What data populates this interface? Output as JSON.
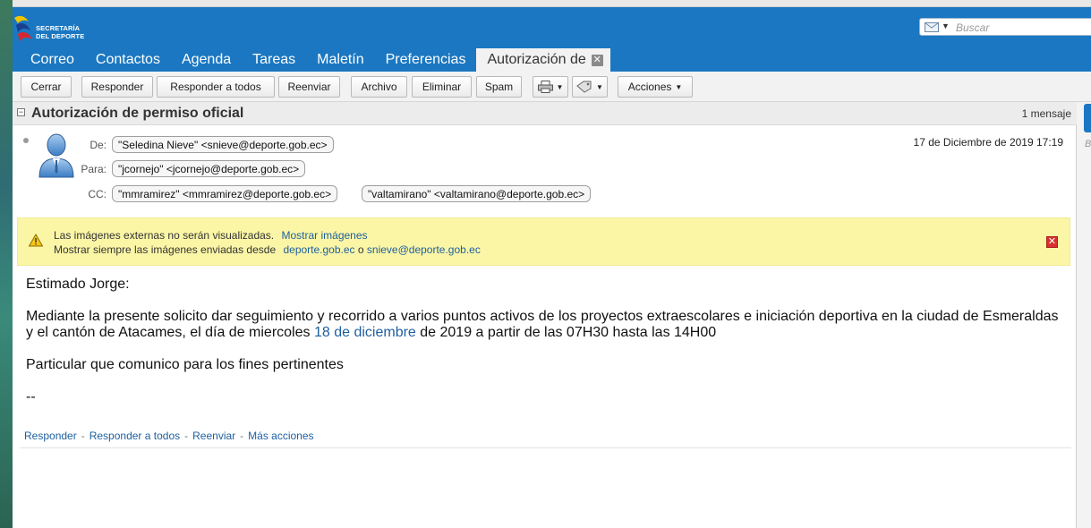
{
  "app": {
    "logo_lines": [
      "SECRETARÍA",
      "DEL DEPORTE"
    ]
  },
  "search": {
    "placeholder": "Buscar"
  },
  "tabs": [
    {
      "label": "Correo"
    },
    {
      "label": "Contactos"
    },
    {
      "label": "Agenda"
    },
    {
      "label": "Tareas"
    },
    {
      "label": "Maletín"
    },
    {
      "label": "Preferencias"
    },
    {
      "label": "Autorización de",
      "active": true
    }
  ],
  "toolbar": {
    "close": "Cerrar",
    "reply": "Responder",
    "reply_all": "Responder a todos",
    "forward": "Reenviar",
    "archive": "Archivo",
    "delete": "Eliminar",
    "spam": "Spam",
    "actions": "Acciones"
  },
  "message": {
    "subject": "Autorización de permiso oficial",
    "count": "1 mensaje",
    "labels": {
      "from": "De:",
      "to": "Para:",
      "cc": "CC:"
    },
    "from": "\"Seledina Nieve\" <snieve@deporte.gob.ec>",
    "to": "\"jcornejo\" <jcornejo@deporte.gob.ec>",
    "cc": [
      "\"mmramirez\" <mmramirez@deporte.gob.ec>",
      "\"valtamirano\" <valtamirano@deporte.gob.ec>"
    ],
    "date": "17 de Diciembre de 2019 17:19"
  },
  "warning": {
    "line1": "Las imágenes externas no serán visualizadas.",
    "show_images": "Mostrar imágenes",
    "line2": "Mostrar siempre las imágenes enviadas desde",
    "domain": "deporte.gob.ec",
    "or": "o",
    "sender": "snieve@deporte.gob.ec"
  },
  "body": {
    "greeting": "Estimado Jorge:",
    "p1_part1": "Mediante la presente solicito dar seguimiento y recorrido a varios puntos activos de los proyectos extraescolares e iniciación deportiva en la ciudad de Esmeraldas y el cantón de Atacames, el día de miercoles",
    "p1_date": "18 de diciembre",
    "p1_part2": "de 2019 a partir de las 07H30 hasta las 14H00",
    "p2": "Particular que comunico para los fines pertinentes",
    "signature": "--"
  },
  "footer": {
    "reply": "Responder",
    "reply_all": "Responder a todos",
    "forward": "Reenviar",
    "more": "Más acciones",
    "sep": "-"
  },
  "colors": {
    "header": "#1b77c1",
    "warning_bg": "#fbf6a6",
    "link": "#1e5f9e"
  }
}
